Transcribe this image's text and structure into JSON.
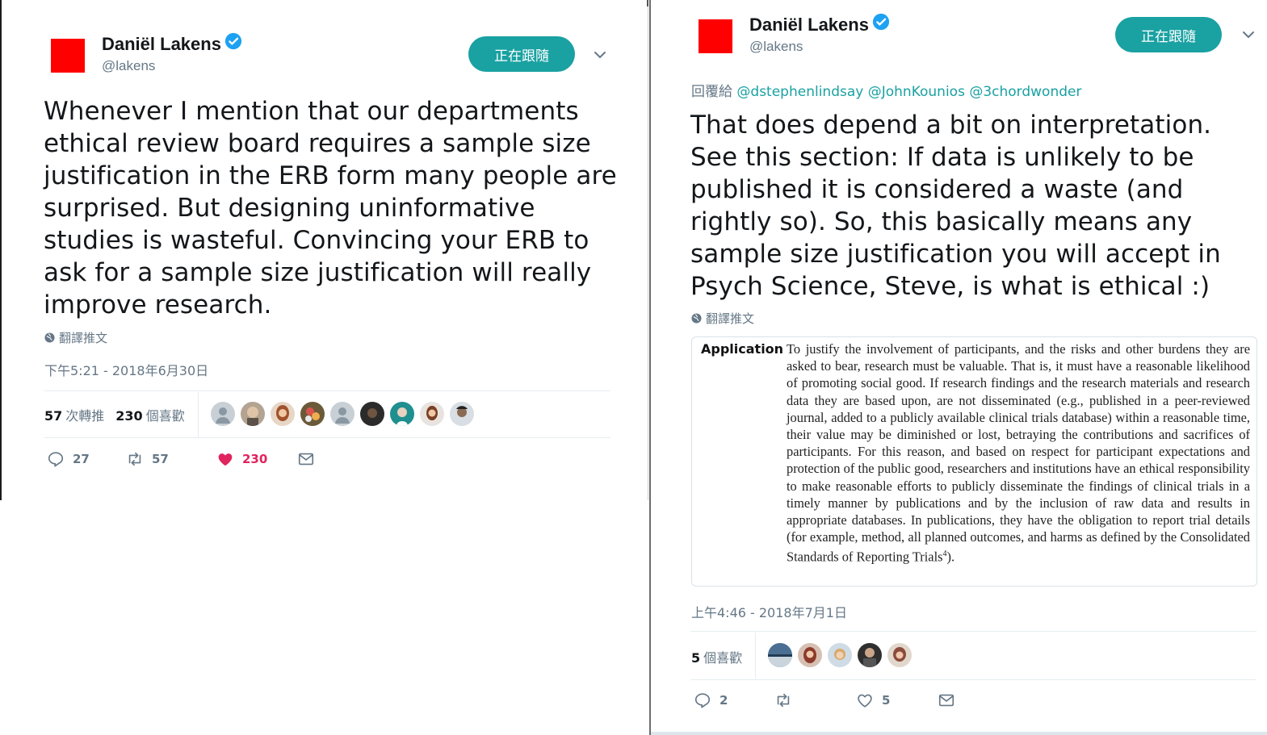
{
  "left_tweet": {
    "author": {
      "display_name": "Daniël Lakens",
      "handle": "@lakens"
    },
    "follow_label": "正在跟隨",
    "text": "Whenever I mention that our departments ethical review board requires a sample size justification in the ERB form many people are surprised. But designing uninformative studies is wasteful. Convincing your ERB to ask for a sample size justification will really improve research.",
    "translate_label": "翻譯推文",
    "timestamp": "下午5:21 - 2018年6月30日",
    "stats": {
      "retweets_count": "57",
      "retweets_label": "次轉推",
      "likes_count": "230",
      "likes_label": "個喜歡"
    },
    "actions": {
      "replies": "27",
      "retweets": "57",
      "likes": "230"
    }
  },
  "right_tweet": {
    "author": {
      "display_name": "Daniël Lakens",
      "handle": "@lakens"
    },
    "follow_label": "正在跟隨",
    "reply_prefix": "回覆給",
    "reply_mentions": "@dstephenlindsay @JohnKounios @3chordwonder",
    "text": "That does depend a bit on interpretation. See this section: If data is unlikely to be published it is considered a waste (and rightly so). So, this basically means any sample size justification you will accept in Psych Science, Steve, is what is ethical :)",
    "translate_label": "翻譯推文",
    "embedded_image": {
      "label": "Application",
      "body": "To justify the involvement of participants, and the risks and other burdens they are asked to bear, research must be valuable. That is, it must have a reasonable likelihood of promoting social good. If research findings and the research materials and research data they are based upon, are not disseminated (e.g., published in a peer-reviewed journal, added to a publicly available clinical trials database) within a reasonable time, their value may be diminished or lost, betraying the contributions and sacrifices of participants. For this reason, and based on respect for participant expectations and protection of the public good, researchers and institutions have an ethical responsibility to make reasonable efforts to publicly disseminate the findings of clinical trials in a timely manner by publications and by the inclusion of raw data and results in appropriate databases. In publications, they have the obligation to report trial details (for example, method, all planned outcomes, and harms as defined by the Consolidated Standards of Reporting Trials",
      "footnote": "4",
      "tail": ")."
    },
    "timestamp": "上午4:46 - 2018年7月1日",
    "stats": {
      "likes_count": "5",
      "likes_label": "個喜歡"
    },
    "actions": {
      "replies": "2",
      "retweets": "",
      "likes": "5"
    }
  },
  "colors": {
    "accent": "#1aa1a2",
    "like": "#e0245e",
    "avatar": "#ff0000",
    "verified": "#1da1f2"
  }
}
